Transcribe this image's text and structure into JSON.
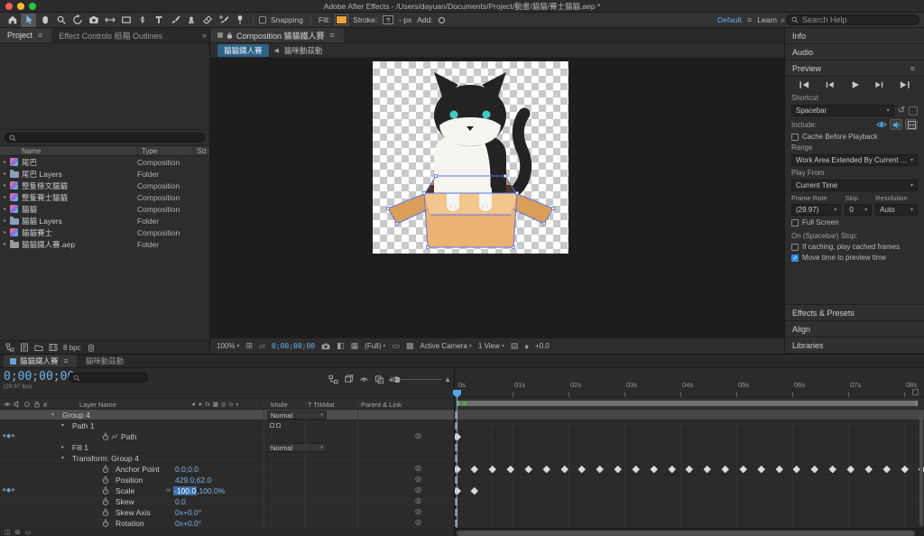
{
  "colors": {
    "accent_blue": "#2d8ceb",
    "value_blue": "#7cb1e3",
    "fill_swatch": "#eda33f",
    "cache_green": "#46b848"
  },
  "titlebar": {
    "title": "Adobe After Effects - /Users/dayuan/Documents/Project/動畫/貓貓/賽士貓貓.aep *"
  },
  "toolbar": {
    "tools": [
      "home-tool",
      "selection-tool",
      "hand-tool",
      "zoom-tool",
      "rotation-tool",
      "camera-tool",
      "pan-behind-tool",
      "shape-tool",
      "pen-tool",
      "type-tool",
      "brush-tool",
      "clone-stamp-tool",
      "eraser-tool",
      "roto-brush-tool",
      "puppet-pin-tool"
    ],
    "active_tool_index": 1,
    "snapping_label": "Snapping",
    "fill_label": "Fill:",
    "stroke_label": "Stroke:",
    "stroke_swatch": "?",
    "stroke_width": "- px",
    "add_label": "Add:",
    "workspace_label": "Default",
    "workspace_menu": "≡",
    "learn_label": "Learn",
    "overflow_chevrons": "»",
    "help_search_placeholder": "Search Help"
  },
  "project_panel": {
    "tabs": [
      {
        "label": "Project",
        "active": true
      },
      {
        "label": "Effect Controls 紙箱 Outlines",
        "active": false
      }
    ],
    "overflow_chevrons": "»",
    "columns": {
      "name": "Name",
      "type": "Type",
      "size": "Siz"
    },
    "rows": [
      {
        "name": "尾巴",
        "type": "Composition",
        "icon": "composition-icon"
      },
      {
        "name": "尾巴 Layers",
        "type": "Folder",
        "icon": "folder-icon"
      },
      {
        "name": "整隻條文貓貓",
        "type": "Composition",
        "icon": "composition-icon"
      },
      {
        "name": "整隻賽士貓貓",
        "type": "Composition",
        "icon": "composition-icon"
      },
      {
        "name": "貓貓",
        "type": "Composition",
        "icon": "composition-icon"
      },
      {
        "name": "貓貓 Layers",
        "type": "Folder",
        "icon": "folder-icon"
      },
      {
        "name": "貓貓賽士",
        "type": "Composition",
        "icon": "composition-icon"
      },
      {
        "name": "貓貓鐵人賽.aep",
        "type": "Folder",
        "icon": "project-icon"
      }
    ],
    "footer_bpc": "8 bpc"
  },
  "comp_panel": {
    "tab_label": "Composition 貓貓鐵人賽",
    "tab_menu": "≡",
    "breadcrumb_current": "貓貓鐵人賽",
    "breadcrumb_parent": "貓咪動茲動",
    "zoom": "100%",
    "time": "0;00;00;00",
    "resolution": "(Full)",
    "camera": "Active Camera",
    "view_count": "1 View",
    "exposure": "+0.0"
  },
  "right_panel": {
    "info_label": "Info",
    "audio_label": "Audio",
    "preview_label": "Preview",
    "preview_menu": "≡",
    "effects_label": "Effects & Presets",
    "align_label": "Align",
    "libraries_label": "Libraries",
    "preview": {
      "transport": [
        "first-frame",
        "previous-frame",
        "play",
        "next-frame",
        "last-frame"
      ],
      "shortcut_label": "Shortcut",
      "shortcut_value": "Spacebar",
      "include_label": "Include:",
      "include_icons": [
        "video-icon",
        "audio-icon",
        "overlays-icon"
      ],
      "cache_before_label": "Cache Before Playback",
      "cache_before_checked": false,
      "range_label": "Range",
      "range_value": "Work Area Extended By Current ...",
      "play_from_label": "Play From",
      "play_from_value": "Current Time",
      "frame_rate_label": "Frame Rate",
      "skip_label": "Skip",
      "resolution_label": "Resolution",
      "frame_rate_value": "(29.97)",
      "skip_value": "0",
      "resolution_value": "Auto",
      "full_screen_label": "Full Screen",
      "full_screen_checked": false,
      "on_stop_label": "On (Spacebar) Stop:",
      "caching_play_label": "If caching, play cached frames",
      "caching_play_checked": false,
      "move_time_label": "Move time to preview time",
      "move_time_checked": true
    }
  },
  "timeline": {
    "tabs": [
      {
        "label": "貓貓鐵人賽",
        "active": true
      },
      {
        "label": "貓咪動茲動",
        "active": false
      }
    ],
    "time_display": "0;00;00;00",
    "fps_label": "(29.97 fps)",
    "columns": {
      "index": "#",
      "layer_name": "Layer Name",
      "switches": "♦ ∗ fx ▦ ◎ ⊙ ◐",
      "mode": "Mode",
      "trkmat": "T TrkMat",
      "parent": "Parent & Link"
    },
    "rows": [
      {
        "label": "Group 4",
        "indent": 1,
        "twirl": "open",
        "mode": "Normal",
        "selected": true
      },
      {
        "label": "Path 1",
        "indent": 2,
        "twirl": "open",
        "mode_icons": true
      },
      {
        "label": "Path",
        "indent": 3,
        "stopwatch": true,
        "graph": true,
        "nav_keyframe": true,
        "pickwhip": true
      },
      {
        "label": "Fill 1",
        "indent": 2,
        "twirl": "closed",
        "mode": "Normal"
      },
      {
        "label": "Transform: Group 4",
        "indent": 2,
        "twirl": "open"
      },
      {
        "label": "Anchor Point",
        "indent": 3,
        "stopwatch": true,
        "value": "0.0,0.0",
        "pickwhip": true
      },
      {
        "label": "Position",
        "indent": 3,
        "stopwatch": true,
        "value": "429.0,62.0",
        "pickwhip": true
      },
      {
        "label": "Scale",
        "indent": 3,
        "stopwatch": true,
        "nav_keyframe": true,
        "link": true,
        "value_selected": "-100.0",
        "value": ",100.0%",
        "pickwhip": true
      },
      {
        "label": "Skew",
        "indent": 3,
        "stopwatch": true,
        "value": "0.0",
        "pickwhip": true
      },
      {
        "label": "Skew Axis",
        "indent": 3,
        "stopwatch": true,
        "value": "0x+0.0°",
        "pickwhip": true
      },
      {
        "label": "Rotation",
        "indent": 3,
        "stopwatch": true,
        "value": "0x+0.0°",
        "pickwhip": true
      }
    ],
    "ruler_labels": [
      "0s",
      "01s",
      "02s",
      "03s",
      "04s",
      "05s",
      "06s",
      "07s",
      "08s"
    ],
    "seconds_per_label": 1,
    "keyframes": [
      {
        "row_index": 2,
        "positions_s": [
          0
        ]
      },
      {
        "row_index": 5,
        "count": 27,
        "interval_s": 0.32
      },
      {
        "row_index": 7,
        "positions_s": [
          0,
          0.32
        ]
      }
    ]
  }
}
